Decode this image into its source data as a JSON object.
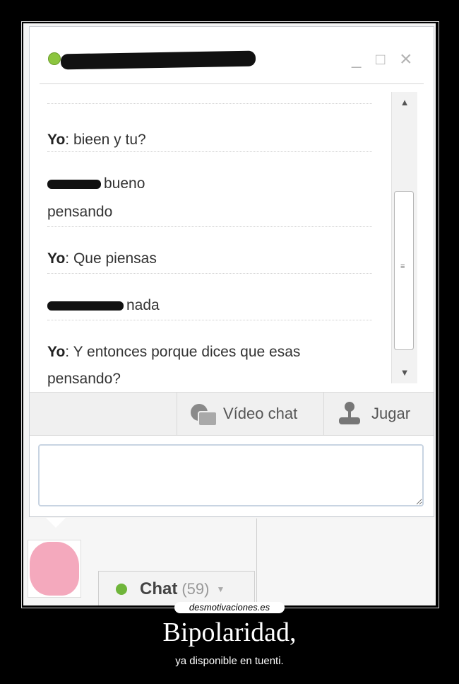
{
  "window": {
    "controls": {
      "minimize": "_",
      "maximize": "□",
      "close": "×"
    }
  },
  "messages": [
    {
      "sender": "Yo",
      "text": ": bieen y tu?"
    },
    {
      "sender": "",
      "text": "bueno"
    },
    {
      "sender": "",
      "text": "pensando"
    },
    {
      "sender": "Yo",
      "text": ": Que piensas"
    },
    {
      "sender": "",
      "text": "nada"
    },
    {
      "sender": "Yo",
      "text": ": Y entonces porque dices que esas"
    },
    {
      "sender": "",
      "text": "pensando?"
    }
  ],
  "scrollbar": {
    "up_arrow": "▲",
    "down_arrow": "▼",
    "grip": "≡"
  },
  "toolbar": {
    "video_chat_label": "Vídeo chat",
    "play_label": "Jugar"
  },
  "input": {
    "placeholder": ""
  },
  "bottom_bar": {
    "chat_label": "Chat",
    "chat_count": "(59)",
    "dropdown_arrow": "▼"
  },
  "poster": {
    "watermark": "desmotivaciones.es",
    "title": "Bipolaridad,",
    "subtitle": "ya disponible en tuenti."
  },
  "colors": {
    "online_green": "#6fb53a",
    "background": "#000000"
  }
}
